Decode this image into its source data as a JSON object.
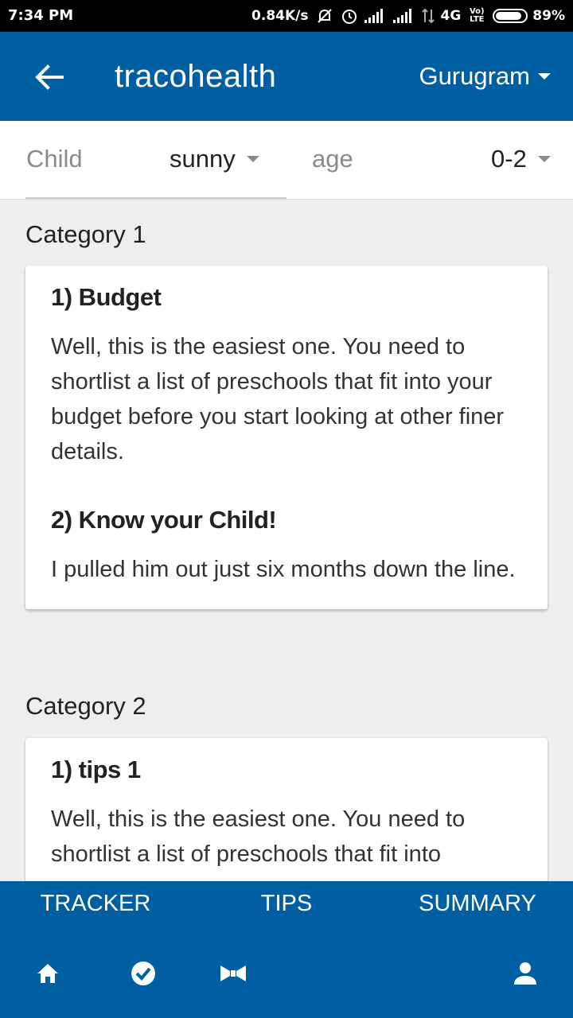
{
  "status_bar": {
    "time": "7:34 PM",
    "net_speed": "0.84K/s",
    "network": "4G",
    "volte": "Vo) LTE",
    "battery": "89%",
    "battery_level": 0.89,
    "icons": [
      "mute-bell-icon",
      "alarm-icon",
      "signal-1-icon",
      "signal-2-icon",
      "data-arrows-icon",
      "battery-icon"
    ]
  },
  "app_bar": {
    "back_icon": "arrow-left-icon",
    "title": "tracohealth",
    "city": "Gurugram"
  },
  "filters": {
    "child_label": "Child",
    "child_value": "sunny",
    "age_label": "age",
    "age_value": "0-2"
  },
  "categories": [
    {
      "heading": "Category 1",
      "tips": [
        {
          "title": "1) Budget",
          "body": "Well, this is the easiest one. You need to shortlist a list of preschools that fit into your budget before you start looking at other finer details."
        },
        {
          "title": "2) Know your Child!",
          "body": "I pulled him out just six months down the line."
        }
      ]
    },
    {
      "heading": "Category 2",
      "tips": [
        {
          "title": "1) tips 1",
          "body": "Well, this is the easiest one. You need to shortlist a list of preschools that fit into"
        }
      ]
    }
  ],
  "bottom_nav": {
    "tabs": [
      "TRACKER",
      "TIPS",
      "SUMMARY"
    ],
    "icons": [
      "home-icon",
      "check-circle-icon",
      "bow-tie-icon",
      "person-icon"
    ]
  },
  "colors": {
    "primary": "#005ea3",
    "background": "#eeeeee",
    "card": "#ffffff"
  }
}
